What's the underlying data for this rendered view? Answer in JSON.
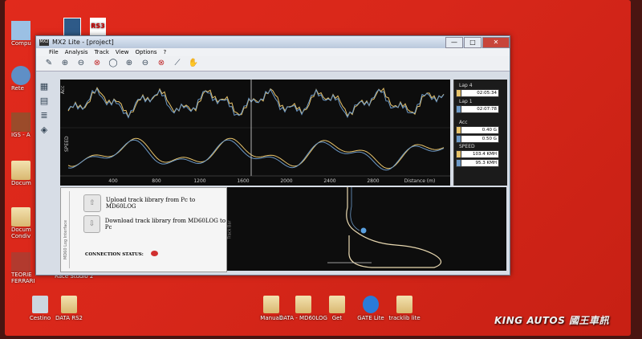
{
  "window": {
    "title": "MX2 Lite - [project]",
    "app_icon_text": "MX2",
    "buttons": {
      "minimize": "—",
      "maximize": "□",
      "close": "✕"
    }
  },
  "menu": [
    "File",
    "Analysis",
    "Track",
    "View",
    "Options",
    "?"
  ],
  "toolbar_icons": [
    "pen-icon",
    "zoom-in-icon",
    "zoom-out-icon",
    "zoom-cancel-icon",
    "zoom-fit-icon",
    "zoom-x-in-icon",
    "zoom-x-out-icon",
    "zoom-x-cancel-icon",
    "measure-icon",
    "hand-icon"
  ],
  "graph": {
    "channels": [
      "Acc",
      "SPEED"
    ],
    "x_ticks": [
      "400",
      "800",
      "1200",
      "1600",
      "2000",
      "2400",
      "2800"
    ],
    "x_label": "Distance (m)",
    "colors": {
      "lap4": "#e8c36a",
      "lap1": "#6d9ac8"
    }
  },
  "legend": {
    "lap4": {
      "label": "Lap 4",
      "value": "02:05:34"
    },
    "lap1": {
      "label": "Lap 1",
      "value": "02:07:78"
    },
    "acc": {
      "label": "Acc",
      "v1": "0.40 G",
      "v2": "0.50 G"
    },
    "speed": {
      "label": "SPEED",
      "v1": "103.4 KMH",
      "v2": "95.3 KMH"
    }
  },
  "panel": {
    "side_label": "MD60 Log Interface",
    "upload": "Upload track library from Pc to MD60LOG",
    "download": "Download track library from MD60LOG to Pc",
    "connection": "CONNECTION STATUS:"
  },
  "track": {
    "side_label": "Track Bar"
  },
  "desktop": {
    "left_icons": [
      "Compu",
      "Rete",
      "IGS - A",
      "Docum",
      "Docum Condiv",
      "TEORIE FERRARI"
    ],
    "top_icons": [
      "",
      "RS3"
    ],
    "bottom_icons": [
      "Cestino",
      "DATA RS2",
      "Manuali",
      "DATA - MD60LOG",
      "Get",
      "GATE Lite",
      "tracklib lite"
    ],
    "taskbar_label": "Race Studio 2"
  },
  "watermark": "KING AUTOS 國王車訊"
}
